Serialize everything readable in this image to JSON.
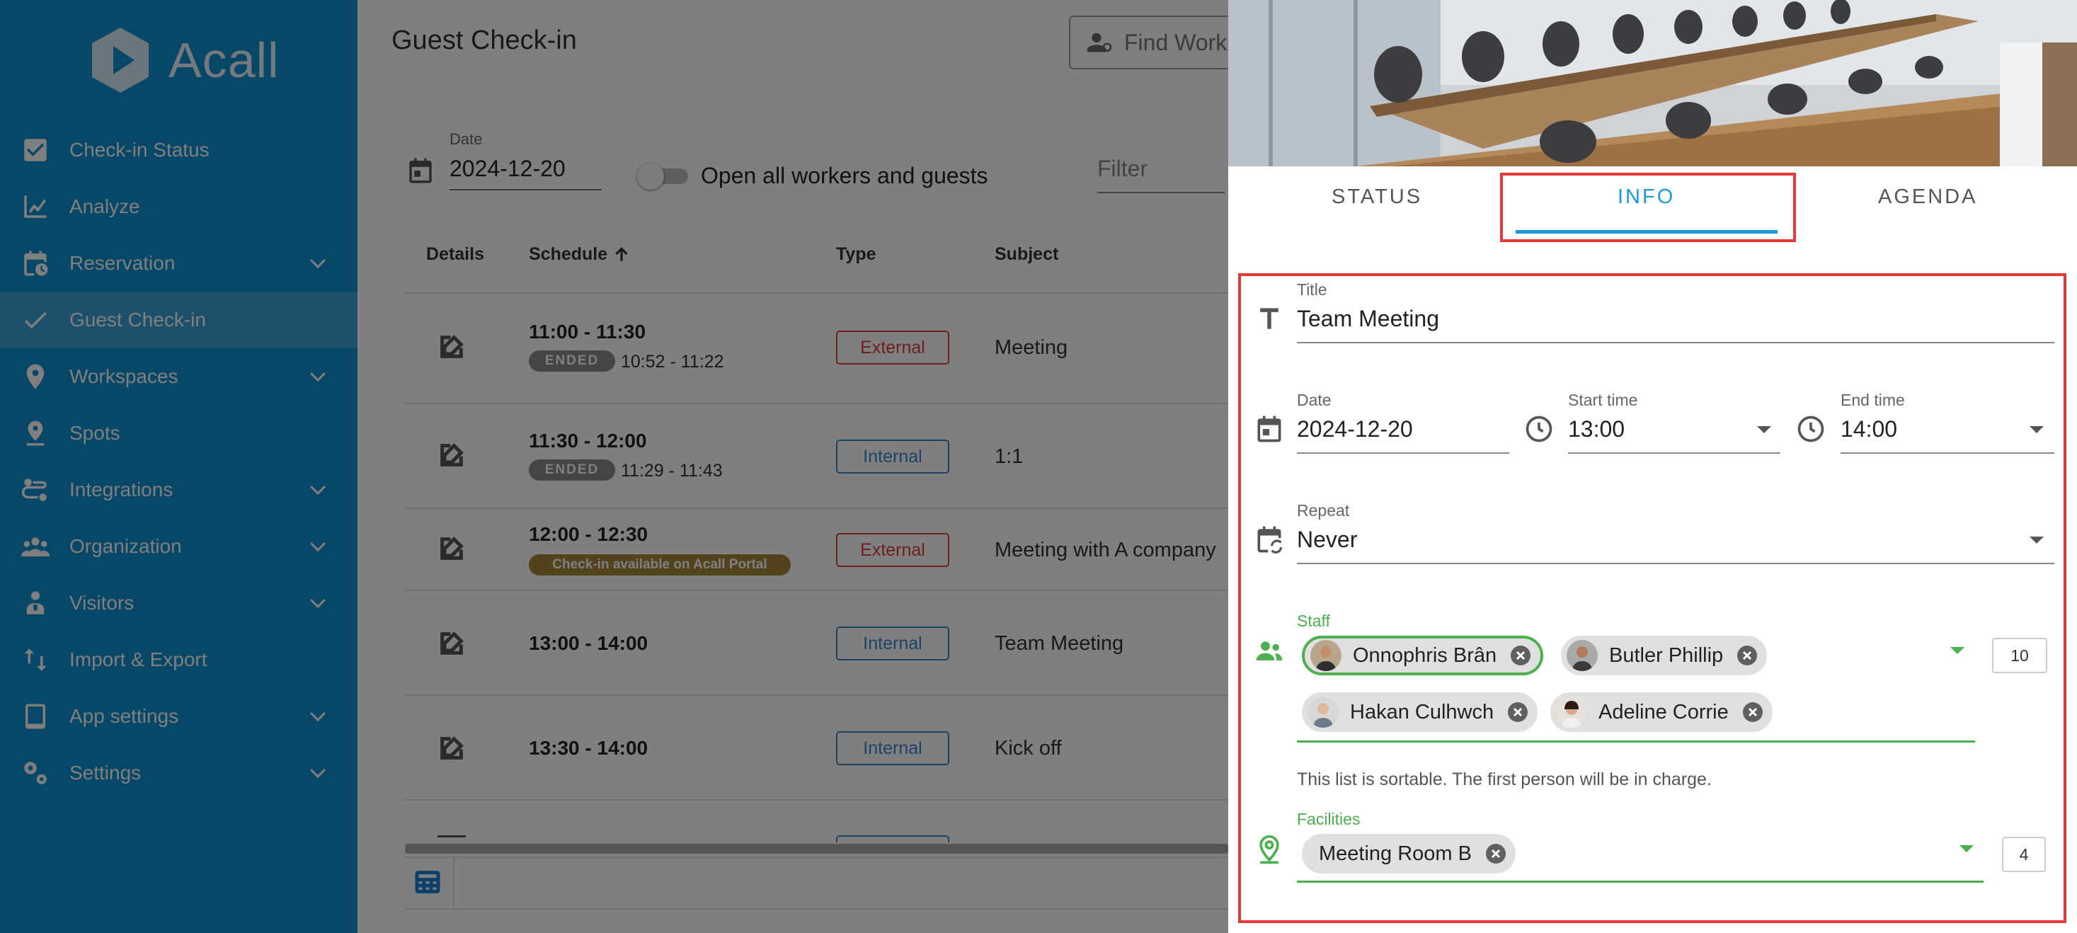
{
  "app": {
    "name": "Acall"
  },
  "sidebar": {
    "items": [
      {
        "label": "Check-in Status",
        "icon": "check-square-icon",
        "expandable": false
      },
      {
        "label": "Analyze",
        "icon": "line-chart-icon",
        "expandable": false
      },
      {
        "label": "Reservation",
        "icon": "calendar-clock-icon",
        "expandable": true
      },
      {
        "label": "Guest Check-in",
        "icon": "checkmark-icon",
        "expandable": false,
        "active": true
      },
      {
        "label": "Workspaces",
        "icon": "location-pin-icon",
        "expandable": true
      },
      {
        "label": "Spots",
        "icon": "spot-pin-icon",
        "expandable": false
      },
      {
        "label": "Integrations",
        "icon": "integrations-icon",
        "expandable": true
      },
      {
        "label": "Organization",
        "icon": "people-group-icon",
        "expandable": true
      },
      {
        "label": "Visitors",
        "icon": "visitor-icon",
        "expandable": true
      },
      {
        "label": "Import & Export",
        "icon": "import-export-icon",
        "expandable": false
      },
      {
        "label": "App settings",
        "icon": "tablet-icon",
        "expandable": true
      },
      {
        "label": "Settings",
        "icon": "gears-icon",
        "expandable": true
      }
    ]
  },
  "main": {
    "title": "Guest Check-in",
    "search_placeholder": "Find Work",
    "date_label": "Date",
    "date_value": "2024-12-20",
    "toggle_label": "Open all workers and guests",
    "filter_placeholder": "Filter",
    "columns": {
      "details": "Details",
      "schedule": "Schedule",
      "type": "Type",
      "subject": "Subject"
    },
    "rows": [
      {
        "time": "11:00 - 11:30",
        "badge": "ENDED",
        "actual": "10:52 - 11:22",
        "type": "External",
        "subject": "Meeting"
      },
      {
        "time": "11:30 - 12:00",
        "badge": "ENDED",
        "actual": "11:29 - 11:43",
        "type": "Internal",
        "subject": "1:1"
      },
      {
        "time": "12:00 - 12:30",
        "badge": "Check-in available on Acall Portal",
        "type": "External",
        "subject": "Meeting with A company"
      },
      {
        "time": "13:00 - 14:00",
        "type": "Internal",
        "subject": "Team Meeting"
      },
      {
        "time": "13:30 - 14:00",
        "type": "Internal",
        "subject": "Kick off"
      }
    ]
  },
  "panel": {
    "tabs": [
      {
        "label": "STATUS"
      },
      {
        "label": "INFO",
        "active": true
      },
      {
        "label": "AGENDA"
      }
    ],
    "title_label": "Title",
    "title_value": "Team Meeting",
    "date_label": "Date",
    "date_value": "2024-12-20",
    "start_label": "Start time",
    "start_value": "13:00",
    "end_label": "End time",
    "end_value": "14:00",
    "repeat_label": "Repeat",
    "repeat_value": "Never",
    "staff_label": "Staff",
    "staff": [
      {
        "name": "Onnophris Brân",
        "selected": true
      },
      {
        "name": "Butler Phillip"
      },
      {
        "name": "Hakan Culhwch"
      },
      {
        "name": "Adeline Corrie"
      }
    ],
    "staff_count": "10",
    "staff_helper": "This list is sortable. The first person will be in charge.",
    "facilities_label": "Facilities",
    "facilities": [
      {
        "name": "Meeting Room B"
      }
    ],
    "facilities_count": "4"
  },
  "colors": {
    "sidebar": "#0f8fcf",
    "accent": "#1b9ad6",
    "external": "#d9413b",
    "internal": "#3a86c8",
    "green": "#4caf50",
    "highlight": "#e53935"
  }
}
